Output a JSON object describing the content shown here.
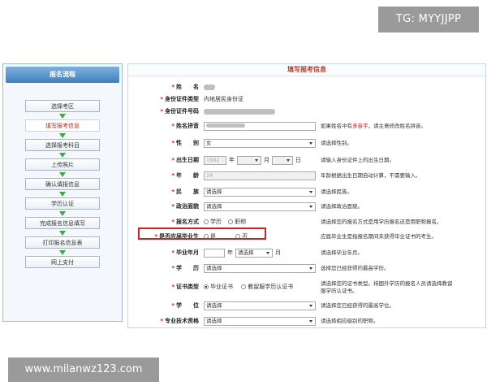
{
  "watermark_top": "TG: MYYJJPP",
  "watermark_bottom": "www.milanwz123.com",
  "sidebar": {
    "title": "报名流程",
    "steps": [
      {
        "label": "选择考区",
        "active": false
      },
      {
        "label": "填写报考信息",
        "active": true
      },
      {
        "label": "选择报考科目",
        "active": false
      },
      {
        "label": "上传照片",
        "active": false
      },
      {
        "label": "确认填报信息",
        "active": false
      },
      {
        "label": "学历认证",
        "active": false
      },
      {
        "label": "完成报名信息填写",
        "active": false
      },
      {
        "label": "打印报名信息表",
        "active": false
      },
      {
        "label": "网上支付",
        "active": false
      }
    ]
  },
  "form": {
    "title": "填写报考信息",
    "name_label": "姓　　名",
    "id_type_label": "身份证件类型",
    "id_type_value": "内地居民身份证",
    "id_number_label": "身份证件号码",
    "pinyin_label": "姓名拼音",
    "pinyin_hint_pre": "如果姓名中有",
    "pinyin_hint_red": "多音字",
    "pinyin_hint_post": "，请主意修改姓名拼音。",
    "gender_label": "性　　别",
    "gender_value": "女",
    "gender_hint": "请选择性别。",
    "birth_label": "出生日期",
    "birth_year": "1992",
    "birth_unit_year": "年",
    "birth_unit_month": "月",
    "birth_unit_day": "日",
    "birth_hint": "请输入身份证件上的出生日期。",
    "age_label": "年　　龄",
    "age_value": "24",
    "age_hint": "年龄根据出生日期自动计算，不需要输入。",
    "ethnic_label": "民　　族",
    "ethnic_value": "请选择",
    "ethnic_hint": "请选择民族。",
    "political_label": "政治面貌",
    "political_value": "请选择",
    "political_hint": "请选择政治面貌。",
    "method_label": "报名方式",
    "method_opt1": "学历",
    "method_opt2": "职称",
    "method_hint": "请选择您的报名方式是用学历报名还是用职称报名。",
    "grad_label": "是否应届毕业生",
    "grad_yes": "是",
    "grad_no": "否",
    "grad_hint": "应届毕业生是指报名期间未获得毕业证书的考生。",
    "grad_year_label": "毕业年月",
    "grad_year_unit": "年",
    "grad_month_select": "请选择",
    "grad_month_unit": "月",
    "grad_year_hint": "请选择毕业年月。",
    "edu_label": "学　　历",
    "edu_value": "请选择",
    "edu_hint": "选择您已经获得的最高学历。",
    "cert_label": "证书类型",
    "cert_opt1": "毕业证书",
    "cert_opt2": "教留服学历认证书",
    "cert_hint_line1": "请选择您的证书类型。持国外学历的报名人员请选择教留",
    "cert_hint_line2": "服学历认证书。",
    "degree_label": "学　　位",
    "degree_value": "请选择",
    "degree_hint": "请选择您已经获得的最高学位。",
    "title_label": "专业技术资格",
    "title_value": "请选择",
    "title_hint": "请选择相应级别的职称。"
  }
}
